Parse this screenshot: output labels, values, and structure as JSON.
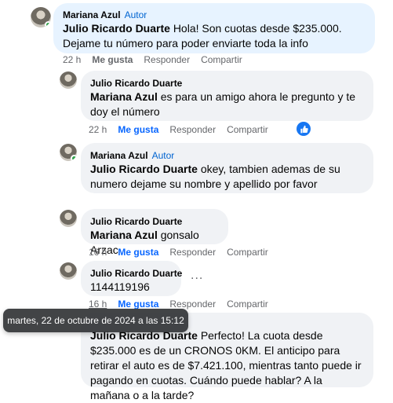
{
  "comments": [
    {
      "author": "Mariana Azul",
      "role": "Autor",
      "mention": "Julio Ricardo Duarte",
      "text": "Hola! Son cuotas desde $235.000. Dejame tu número para poder enviarte toda la info",
      "time": "22 h",
      "like": "Me gusta",
      "reply": "Responder",
      "share": "Compartir"
    },
    {
      "author": "Julio Ricardo Duarte",
      "mention": "Mariana Azul",
      "text": "es para un amigo ahora le pregunto y te doy el número",
      "time": "22 h",
      "like": "Me gusta",
      "reply": "Responder",
      "share": "Compartir",
      "reaction": "like-icon"
    },
    {
      "author": "Mariana Azul",
      "role": "Autor",
      "mention": "Julio Ricardo Duarte",
      "text": "okey, tambien ademas de su numero dejame su nombre y apellido por favor"
    },
    {
      "author": "Julio Ricardo Duarte",
      "mention": "Mariana Azul",
      "text": "gonsalo Arzac",
      "time": "16 h",
      "like": "Me gusta",
      "reply": "Responder",
      "share": "Compartir"
    },
    {
      "author": "Julio Ricardo Duarte",
      "text": "1144119196",
      "time": "16 h",
      "like": "Me gusta",
      "reply": "Responder",
      "share": "Compartir",
      "more": "..."
    },
    {
      "mention": "Julio Ricardo Duarte",
      "text": "Perfecto! La cuota desde $235.000 es de un CRONOS 0KM. El anticipo para retirar el auto es de $7.421.100, mientras tanto puede ir pagando en cuotas. Cuándo puede hablar? A la mañana o a la tarde?"
    }
  ],
  "tooltip": "martes, 22 de octubre de 2024 a las 15:12",
  "colors": {
    "accent": "#0866ff",
    "bubble": "#f0f2f5",
    "highlight": "#e7f3ff",
    "author_badge": "#0064d1"
  }
}
